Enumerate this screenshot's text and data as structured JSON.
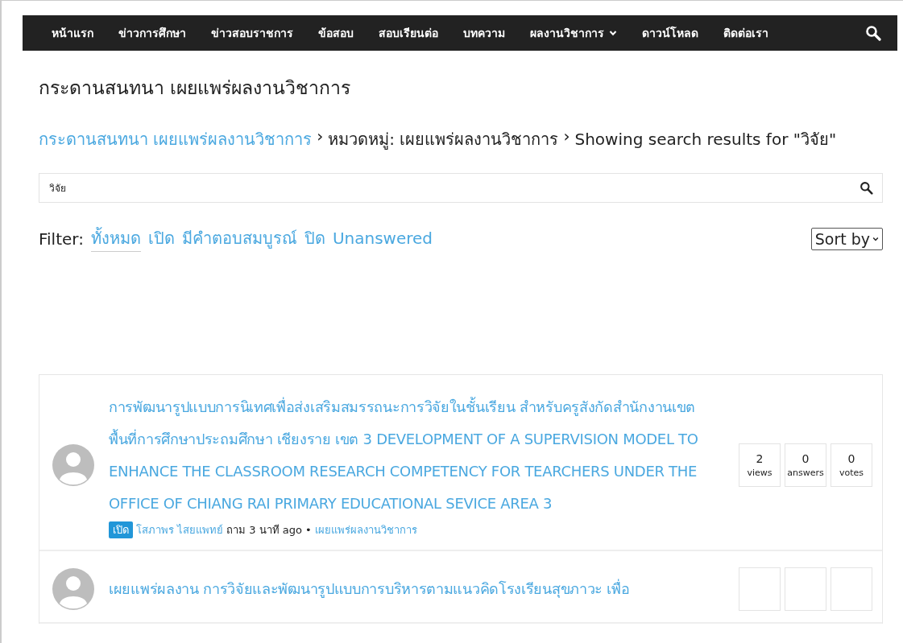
{
  "nav": {
    "items": [
      {
        "label": "หน้าแรก",
        "has_menu": false
      },
      {
        "label": "ข่าวการศึกษา",
        "has_menu": false
      },
      {
        "label": "ข่าวสอบราชการ",
        "has_menu": false
      },
      {
        "label": "ข้อสอบ",
        "has_menu": false
      },
      {
        "label": "สอบเรียนต่อ",
        "has_menu": false
      },
      {
        "label": "บทความ",
        "has_menu": false
      },
      {
        "label": "ผลงานวิชาการ",
        "has_menu": true
      },
      {
        "label": "ดาวน์โหลด",
        "has_menu": false
      },
      {
        "label": "ติดต่อเรา",
        "has_menu": false
      }
    ]
  },
  "page_title": "กระดานสนทนา เผยแพร่ผลงานวิชาการ",
  "breadcrumb": {
    "link": "กระดานสนทนา เผยแพร่ผลงานวิชาการ",
    "separator": "›",
    "category": "หมวดหมู่: เผยแพร่ผลงานวิชาการ",
    "current": "Showing search results for \"วิจัย\""
  },
  "search": {
    "value": "วิจัย"
  },
  "filter": {
    "label": "Filter:",
    "options": [
      {
        "label": "ทั้งหมด",
        "selected": true
      },
      {
        "label": "เปิด",
        "selected": false
      },
      {
        "label": "มีคำตอบสมบูรณ์",
        "selected": false
      },
      {
        "label": "ปิด",
        "selected": false
      },
      {
        "label": "Unanswered",
        "selected": false
      }
    ],
    "sort": "Sort by"
  },
  "questions": [
    {
      "title": "การพัฒนารูปแบบการนิเทศเพื่อส่งเสริมสมรรถนะการวิจัยในชั้นเรียน สำหรับครูสังกัดสำนักงานเขตพื้นที่การศึกษาประถมศึกษา เชียงราย เขต 3 DEVELOPMENT OF A SUPERVISION MODEL TO ENHANCE THE CLASSROOM RESEARCH COMPETENCY FOR TEARCHERS UNDER THE OFFICE OF CHIANG RAI PRIMARY EDUCATIONAL SEVICE AREA 3",
      "status": "เปิด",
      "author": "โสภาพร ไสยแพทย์",
      "asked": "ถาม 3 นาที ago",
      "separator": "•",
      "category": "เผยแพร่ผลงานวิชาการ",
      "stats": [
        {
          "value": "2",
          "label": "views"
        },
        {
          "value": "0",
          "label": "answers"
        },
        {
          "value": "0",
          "label": "votes"
        }
      ]
    },
    {
      "title": "เผยแพร่ผลงาน การวิจัยและพัฒนารูปแบบการบริหารตามแนวคิดโรงเรียนสุขภาวะ เพื่อ"
    }
  ]
}
